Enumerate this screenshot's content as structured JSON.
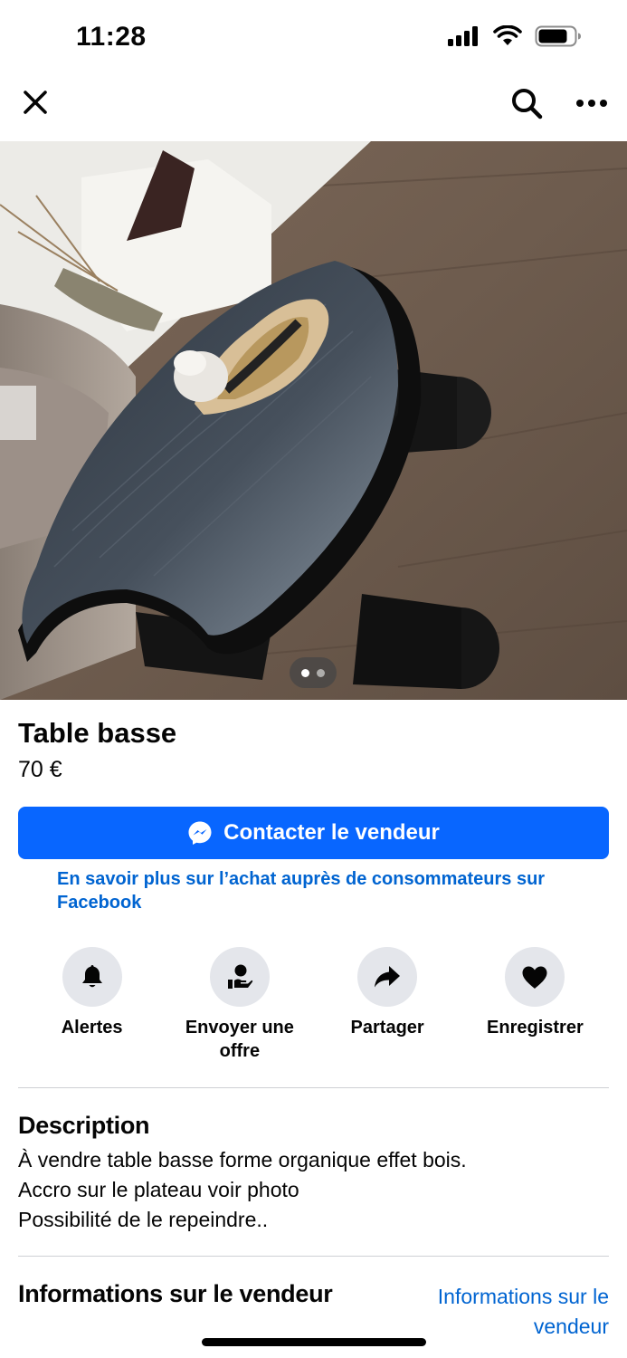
{
  "status_bar": {
    "time": "11:28",
    "icons": [
      "cellular-signal-icon",
      "wifi-icon",
      "battery-icon"
    ]
  },
  "top_nav": {
    "icons": [
      "close-icon",
      "search-icon",
      "more-icon"
    ]
  },
  "photo": {
    "page_count": 2,
    "active_page": 1
  },
  "listing": {
    "title": "Table basse",
    "price": "70 €"
  },
  "contact_button": {
    "label": "Contacter le vendeur",
    "icon": "messenger-icon"
  },
  "learn_more_link": "En savoir plus sur l’achat auprès de consommateurs sur Facebook",
  "actions": [
    {
      "label": "Alertes",
      "icon": "bell-icon"
    },
    {
      "label": "Envoyer une offre",
      "icon": "offer-icon"
    },
    {
      "label": "Partager",
      "icon": "share-icon"
    },
    {
      "label": "Enregistrer",
      "icon": "heart-icon"
    }
  ],
  "description": {
    "heading": "Description",
    "lines": [
      "À vendre table basse forme organique effet bois.",
      "Accro sur le plateau voir photo",
      "Possibilité de le repeindre.."
    ]
  },
  "seller": {
    "heading": "Informations sur le vendeur",
    "link": "Informations sur le vendeur"
  },
  "colors": {
    "primary": "#0866ff",
    "link": "#0064d1",
    "action_bg": "#e4e6eb"
  }
}
